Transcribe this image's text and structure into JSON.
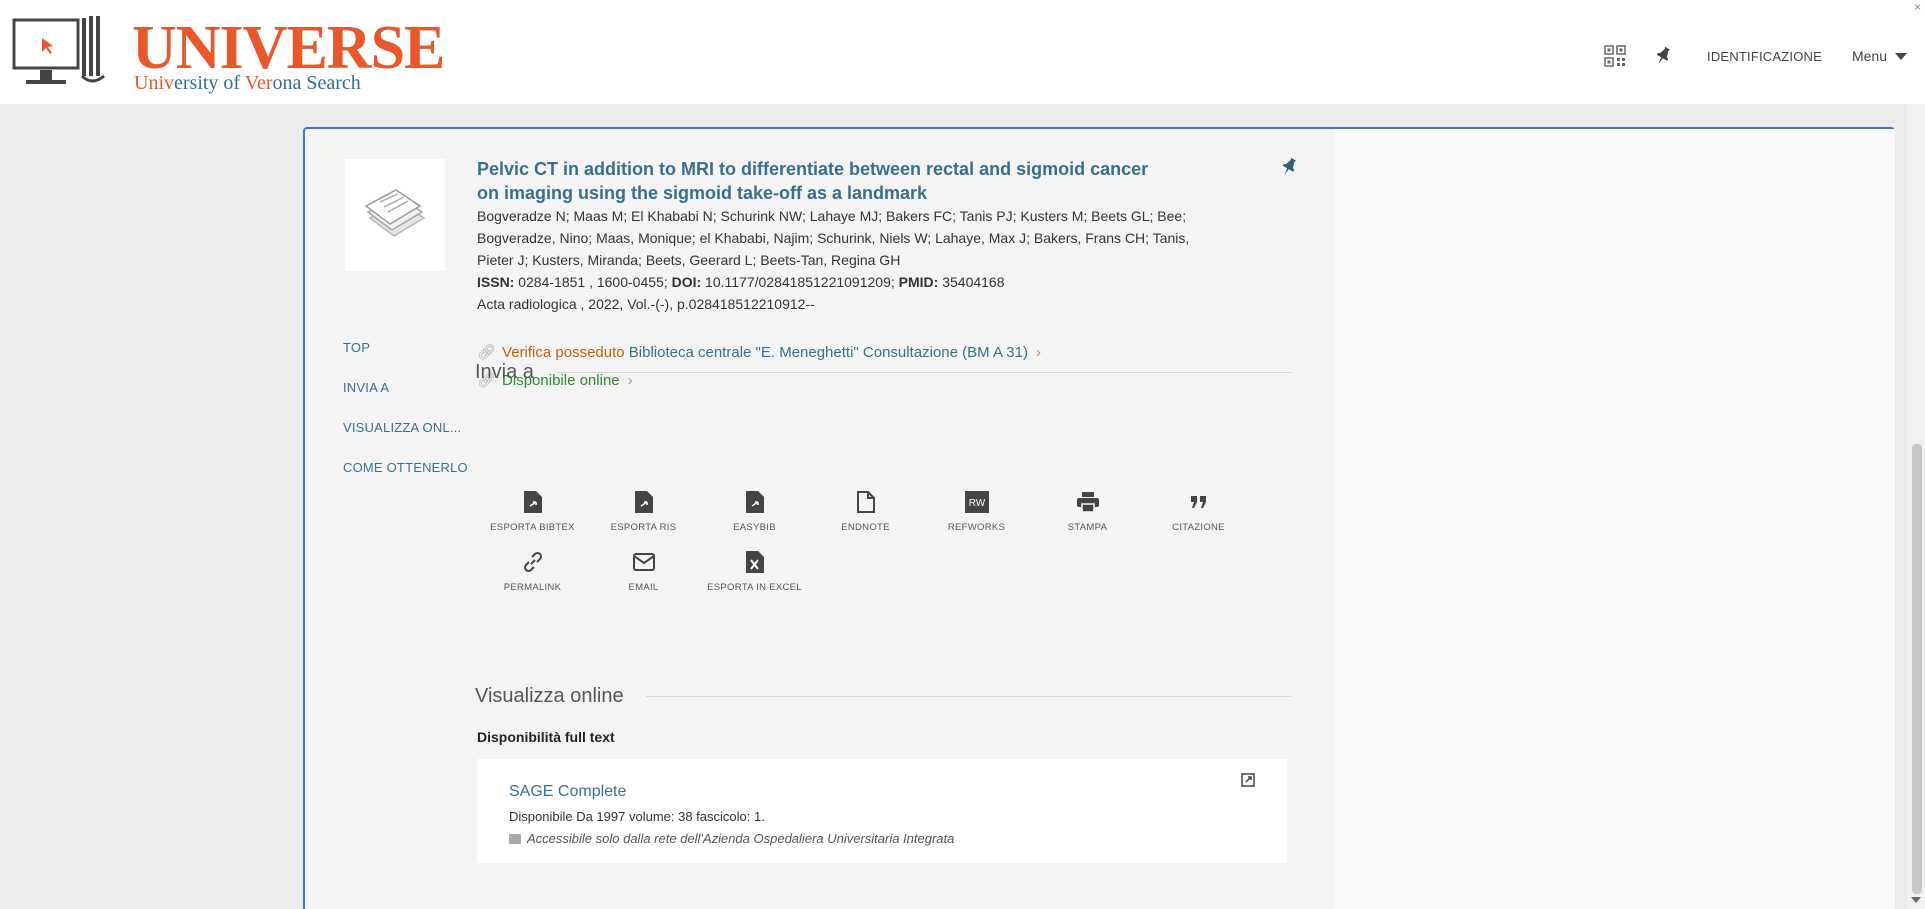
{
  "header": {
    "logo_word": "UNIVERSE",
    "logo_sub_a": "Univ",
    "logo_sub_b": "ersity of ",
    "logo_sub_c": "Ver",
    "logo_sub_d": "ona Search",
    "login_label": "IDENTIFICAZIONE",
    "menu_label": "Menu",
    "close_glyph": "×"
  },
  "record": {
    "title_line1": "Pelvic CT in addition to MRI to differentiate between rectal and sigmoid cancer",
    "title_line2": "on imaging using the sigmoid take-off as a landmark",
    "authors_line1": "Bogveradze N; Maas M; El Khababi N; Schurink NW; Lahaye MJ; Bakers FC; Tanis PJ; Kusters M; Beets GL; Bee;",
    "authors_line2": "Bogveradze, Nino; Maas, Monique; el Khababi, Najim; Schurink, Niels W; Lahaye, Max J; Bakers, Frans CH; Tanis,",
    "authors_line3": "Pieter J; Kusters, Miranda; Beets, Geerard L; Beets-Tan, Regina GH",
    "issn_label": "ISSN:",
    "issn_value": " 0284-1851 , 1600-0455; ",
    "doi_label": "DOI:",
    "doi_value": " 10.1177/02841851221091209; ",
    "pmid_label": "PMID:",
    "pmid_value": " 35404168",
    "source": "Acta radiologica , 2022, Vol.-(-), p.028418512210912--"
  },
  "availability": {
    "check_label": "Verifica posseduto",
    "location": " Biblioteca centrale \"E. Meneghetti\" Consultazione (BM A 31)",
    "online_label": "Disponibile online",
    "chevron": "›"
  },
  "side_nav": {
    "top": "TOP",
    "send_to": "INVIA A",
    "view_online": "VISUALIZZA ONL...",
    "how_to_get": "COME OTTENERLO"
  },
  "send_section": {
    "heading": "Invia a",
    "actions_row1": [
      {
        "label": "ESPORTA BIBTEX",
        "icon": "file-export-icon"
      },
      {
        "label": "ESPORTA RIS",
        "icon": "file-export-icon"
      },
      {
        "label": "EASYBIB",
        "icon": "file-export-icon"
      },
      {
        "label": "ENDNOTE",
        "icon": "document-icon"
      },
      {
        "label": "REFWORKS",
        "icon": "refworks-icon"
      },
      {
        "label": "STAMPA",
        "icon": "printer-icon"
      },
      {
        "label": "CITAZIONE",
        "icon": "quote-icon"
      }
    ],
    "actions_row2": [
      {
        "label": "PERMALINK",
        "icon": "link-icon"
      },
      {
        "label": "EMAIL",
        "icon": "email-icon"
      },
      {
        "label": "ESPORTA IN EXCEL",
        "icon": "excel-icon"
      }
    ]
  },
  "online_section": {
    "heading": "Visualizza online",
    "fulltext_label": "Disponibilità full text",
    "provider_name": "SAGE Complete",
    "provider_desc": "Disponibile Da 1997 volume: 38 fascicolo: 1.",
    "provider_note": "Accessibile solo dalla rete dell'Azienda Ospedaliera Universitaria Integrata"
  },
  "colors": {
    "accent": "#3a7bbf",
    "brand_orange": "#e8582a",
    "link_blue": "#3a6f8c",
    "online_green": "#2e8a2e",
    "check_orange": "#c0620f"
  }
}
